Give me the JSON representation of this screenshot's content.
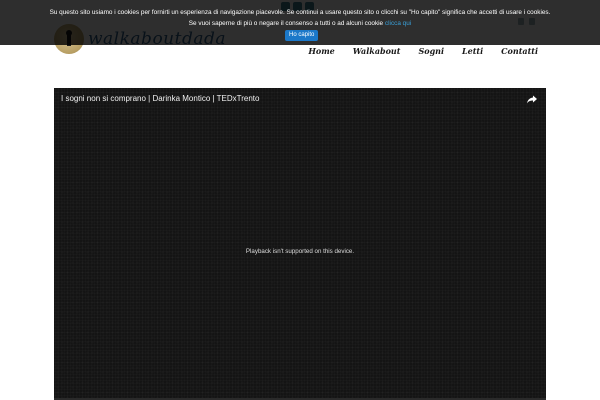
{
  "header": {
    "logo_text": "walkaboutdada",
    "nav": [
      "Home",
      "Walkabout",
      "Sogni",
      "Letti",
      "Contatti"
    ]
  },
  "cookie_banner": {
    "line1": "Su questo sito usiamo i cookies per fornirti un esperienza di navigazione piacevole. Se continui a usare questo sito o clicchi su \"Ho capito\" significa che accetti di usare i cookies.",
    "line2_prefix": "Se vuoi saperne di più o negare il consenso a tutti o ad alcuni cookie",
    "line2_link": "clicca qui",
    "accept_label": "Ho capito"
  },
  "video": {
    "title": "I sogni non si comprano | Darinka Montico | TEDxTrento",
    "message": "Playback isn't supported on this device."
  },
  "icons": [
    "keyhole-logo-icon",
    "facebook-icon",
    "twitter-icon",
    "instagram-icon",
    "share-icon"
  ],
  "colors": {
    "banner_bg": "#000000",
    "accept_button": "#1b78c9",
    "link": "#3aa0d8",
    "player_bg": "#141414"
  }
}
